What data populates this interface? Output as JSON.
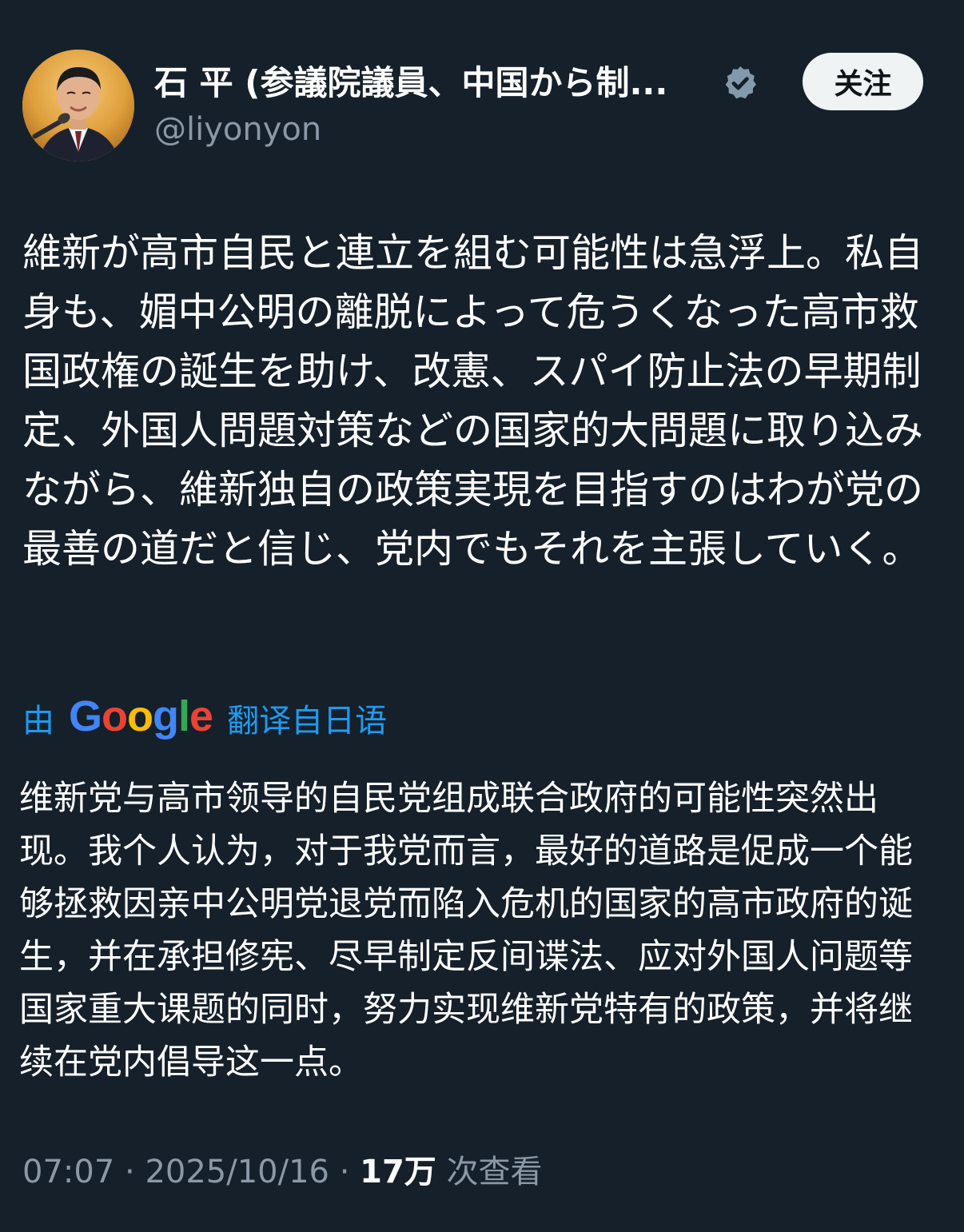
{
  "author": {
    "display_name": "石 平 (参議院議員、中国から制...",
    "handle": "@liyonyon",
    "verified_icon": "verified-badge-icon",
    "follow_label": "关注"
  },
  "tweet": {
    "text": "維新が高市自民と連立を組む可能性は急浮上。私自身も、媚中公明の離脱によって危うくなった高市救国政権の誕生を助け、改憲、スパイ防止法の早期制定、外国人問題対策などの国家的大問題に取り込みながら、維新独自の政策実現を目指すのはわが党の最善の道だと信じ、党内でもそれを主張していく。"
  },
  "translation": {
    "prefix": "由",
    "provider": "Google",
    "suffix": "翻译自日语",
    "text": "维新党与高市领导的自民党组成联合政府的可能性突然出现。我个人认为，对于我党而言，最好的道路是促成一个能够拯救因亲中公明党退党而陷入危机的国家的高市政府的诞生，并在承担修宪、尽早制定反间谍法、应对外国人问题等国家重大课题的同时，努力实现维新党特有的政策，并将继续在党内倡导这一点。"
  },
  "meta": {
    "time": "07:07",
    "separator": "·",
    "date": "2025/10/16",
    "views": "17万",
    "views_label": "次查看"
  },
  "colors": {
    "background": "#15202b",
    "secondary_text": "#8b98a5",
    "link_blue": "#1d9bf0"
  }
}
